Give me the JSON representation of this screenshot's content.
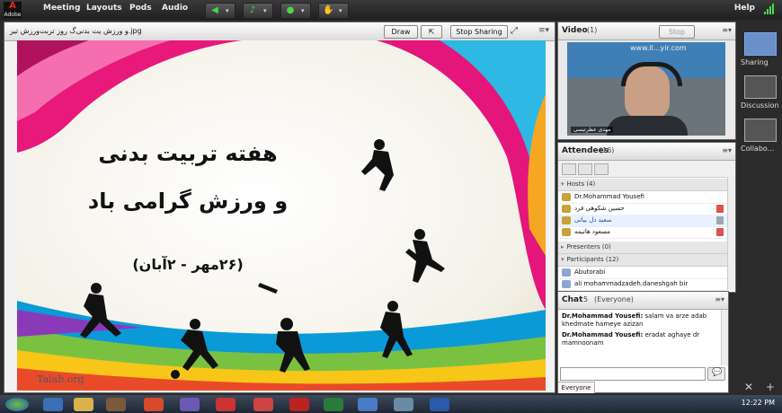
{
  "app": {
    "logo_text": "Adobe",
    "menu": [
      "Meeting",
      "Layouts",
      "Pods",
      "Audio"
    ],
    "help_label": "Help"
  },
  "share_pod": {
    "filename": "و ورزش یت بدنی‌‌گ روز تربت‌ورزش تیر.jpg",
    "draw_label": "Draw",
    "stop_sharing_label": "Stop Sharing",
    "slide": {
      "title_line1": "هفته تربیت بدنی",
      "title_line2": "و ورزش گرامی باد",
      "date_line": "(۲۶مهر - ۲آبان)",
      "credit": "Talab.org"
    }
  },
  "video_pod": {
    "title": "Video",
    "count": "(1)",
    "stop_label": "Stop",
    "watermark": "www.ll...yir.com",
    "presenter_label": "مهدی عظرتیسی"
  },
  "attendees_pod": {
    "title": "Attendees",
    "count": "(16)",
    "hosts_label": "Hosts (4)",
    "hosts": [
      "Dr.Mohammad Yousefi",
      "حسین شکوهی فرد",
      "سعید دل بیاتی",
      "مسعود هاتیمه"
    ],
    "presenters_label": "Presenters (0)",
    "participants_label": "Participants (12)",
    "participants": [
      "Abutorabi",
      "ali mohammadzadeh.daneshgah bir"
    ]
  },
  "chat_pod": {
    "title": "Chat",
    "count": "5",
    "audience": "(Everyone)",
    "messages": [
      {
        "sender": "Dr.Mohammad Yousefi:",
        "text": "salam va arze adab khedmate hameye azizan"
      },
      {
        "sender": "Dr.Mohammad Yousefi:",
        "text": "eradat aghaye dr mamnoonam"
      }
    ],
    "tab_label": "Everyone"
  },
  "layouts": [
    {
      "label": "Sharing",
      "active": true
    },
    {
      "label": "Discussion",
      "active": false
    },
    {
      "label": "Collabo...",
      "active": false
    }
  ],
  "taskbar": {
    "clock": "12:22 PM"
  },
  "colors": {
    "accent_green": "#49d84a",
    "selected_layout": "#6a8fc9"
  }
}
